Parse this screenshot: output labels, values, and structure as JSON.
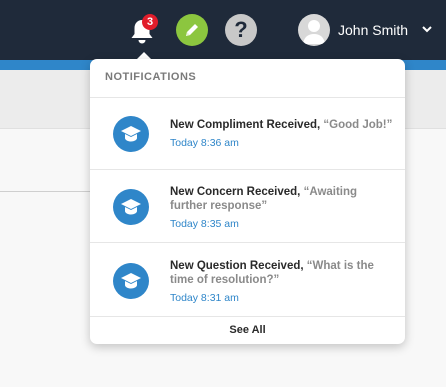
{
  "header": {
    "notification_count": "3",
    "user_name": "John Smith",
    "help_symbol": "?"
  },
  "dropdown": {
    "header": "NOTIFICATIONS",
    "items": [
      {
        "title": "New Compliment Received,",
        "quote": "“Good Job!”",
        "time": "Today 8:36 am",
        "icon": "graduation-cap-icon"
      },
      {
        "title": "New Concern Received,",
        "quote": "“Awaiting further response”",
        "time": "Today 8:35 am",
        "icon": "graduation-cap-icon"
      },
      {
        "title": "New Question Received,",
        "quote": "“What is the time of resolution?”",
        "time": "Today 8:31 am",
        "icon": "graduation-cap-icon"
      }
    ],
    "see_all": "See All"
  },
  "colors": {
    "topbar": "#1f2a3a",
    "accent_blue": "#2f86c9",
    "badge_red": "#e11d2b",
    "edit_green": "#8cc63f"
  }
}
